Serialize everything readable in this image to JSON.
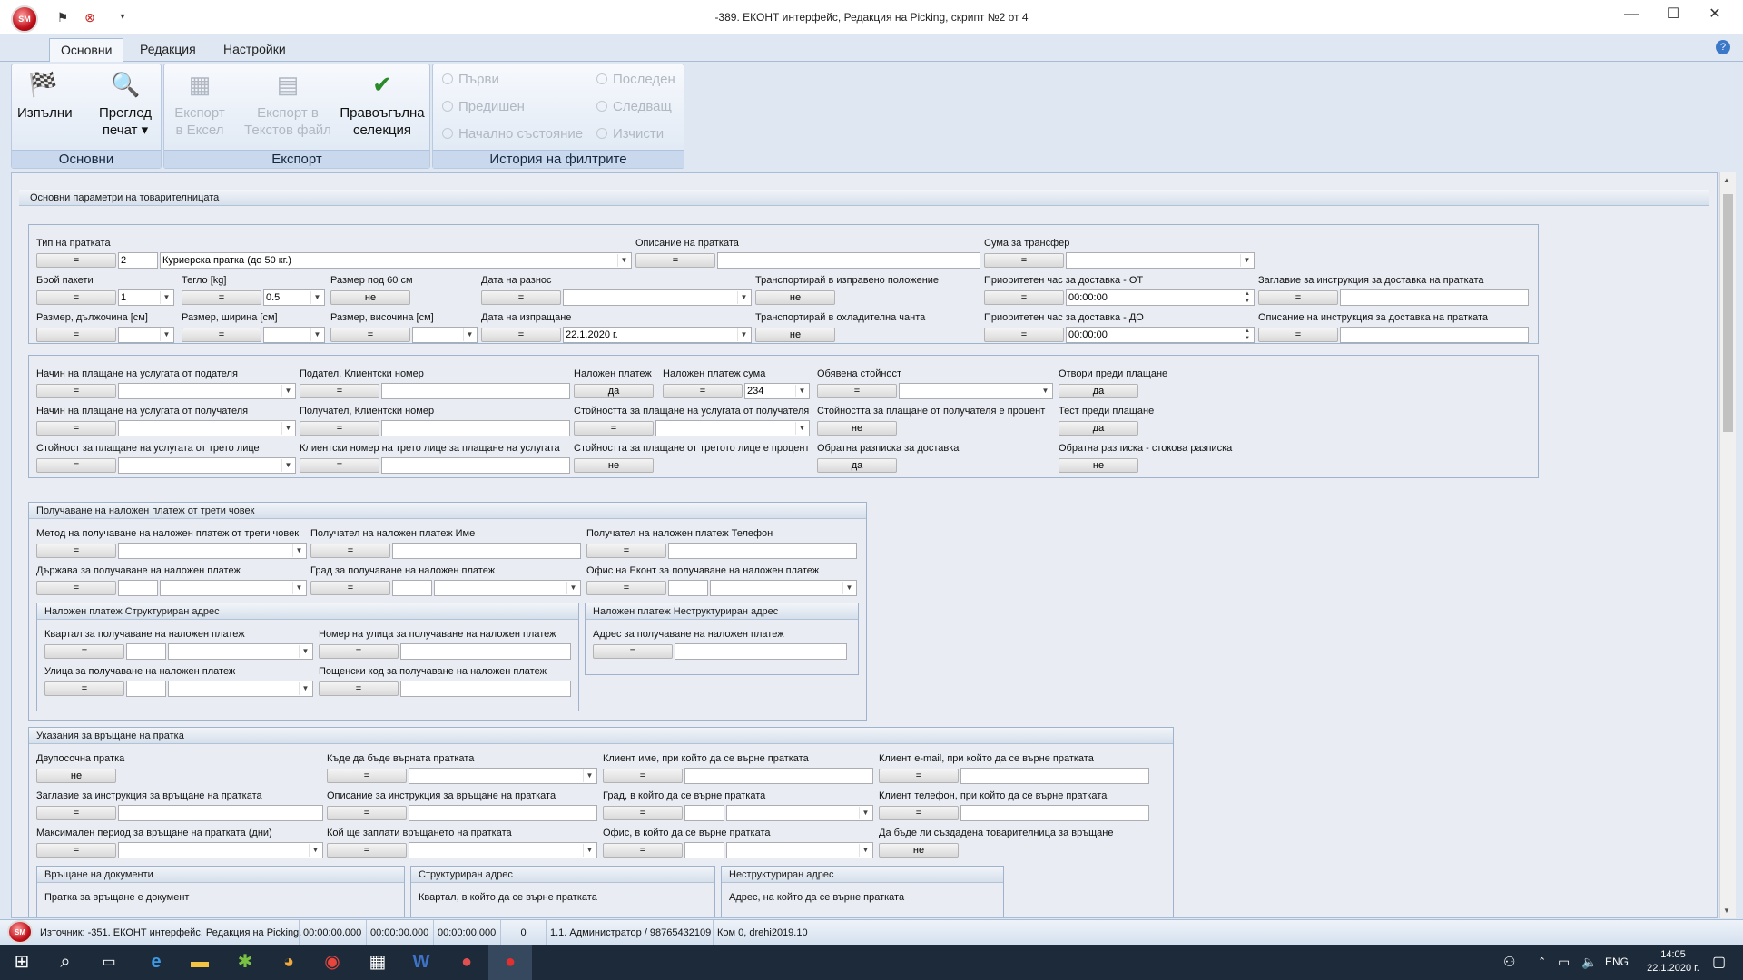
{
  "window": {
    "title": "-389. ЕКОНТ интерфейс, Редакция на Picking, скрипт №2 от 4",
    "app_logo": "SM",
    "controls": {
      "minimize": "—",
      "maximize": "☐",
      "close": "✕"
    }
  },
  "ribbon": {
    "tabs": [
      "Основни",
      "Редакция",
      "Настройки"
    ],
    "groups": {
      "osnovni": {
        "caption": "Основни",
        "buttons": [
          "Изпълни",
          "Преглед\nпечат ▾"
        ]
      },
      "export": {
        "caption": "Експорт",
        "buttons": [
          "Експорт\nв Ексел",
          "Експорт в\nТекстов файл",
          "Правоъгълна\nселекция"
        ]
      },
      "history": {
        "caption": "История на филтрите",
        "buttons": [
          "Първи",
          "Последен",
          "Предишен",
          "Следващ",
          "Начално състояние",
          "Изчисти"
        ]
      }
    }
  },
  "eq": "=",
  "sections": {
    "main": {
      "title": "Основни параметри на товарителницата"
    },
    "cod": {
      "title": "Получаване на наложен платеж от трети човек"
    },
    "codStruct": {
      "title": "Наложен платеж Структуриран адрес"
    },
    "codUnstruct": {
      "title": "Наложен платеж Неструктуриран адрес"
    },
    "ret": {
      "title": "Указания за връщане на пратка"
    },
    "retDocs": {
      "title": "Връщане на документи"
    },
    "retStruct": {
      "title": "Структуриран адрес"
    },
    "retUnstruct": {
      "title": "Неструктуриран адрес"
    }
  },
  "fields": {
    "tip": {
      "label": "Тип на пратката",
      "code": "2",
      "value": "Куриерска пратка (до 50 кг.)"
    },
    "opisanie": {
      "label": "Описание на пратката"
    },
    "suma": {
      "label": "Сума за трансфер"
    },
    "paketi": {
      "label": "Брой пакети",
      "value": "1"
    },
    "teglo": {
      "label": "Тегло [kg]",
      "value": "0.5"
    },
    "razmer60": {
      "label": "Размер под 60 см",
      "value": "не"
    },
    "razmer60_dup": {
      "label": "Размер под 60 см"
    },
    "dataRaznos": {
      "label": "Дата на разнос"
    },
    "izpraveno": {
      "label": "Транспортирай в изправено положение",
      "value": "не"
    },
    "prioOt": {
      "label": "Приоритетен час за доставка - ОТ",
      "value": "00:00:00"
    },
    "zaglavie": {
      "label": "Заглавие за инструкция за доставка на пратката"
    },
    "dalzhina": {
      "label": "Размер, дължочина [см]"
    },
    "shirina": {
      "label": "Размер, ширина [см]"
    },
    "visochina": {
      "label": "Размер, височина [см]"
    },
    "dataIzprashtane": {
      "label": "Дата на изпращане",
      "value": "22.1.2020 г."
    },
    "hladilna": {
      "label": "Транспортирай в охладителна чанта",
      "value": "не"
    },
    "prioDo": {
      "label": "Приоритетен час за доставка - ДО",
      "value": "00:00:00"
    },
    "opisInstr": {
      "label": "Описание на инструкция за доставка на пратката"
    },
    "plashtanePod": {
      "label": "Начин на плащане на услугата от подателя"
    },
    "podatelNomer": {
      "label": "Подател, Клиентски номер"
    },
    "nalozhen": {
      "label": "Наложен платеж",
      "value": "да"
    },
    "nalozhenSuma": {
      "label": "Наложен платеж сума",
      "value": "234"
    },
    "obyavena": {
      "label": "Обявена стойност"
    },
    "otvori": {
      "label": "Отвори преди плащане",
      "value": "да"
    },
    "plashtanePol": {
      "label": "Начин на плащане на услугата от получателя"
    },
    "poluchatelNomer": {
      "label": "Получател, Клиентски номер"
    },
    "stoynostPol": {
      "label": "Стойността за плащане на услугата от получателя"
    },
    "stoynostPolPct": {
      "label": "Стойността за плащане от получателя е процент",
      "value": "не"
    },
    "test": {
      "label": "Тест преди плащане",
      "value": "да"
    },
    "tretoLice": {
      "label": "Стойност за плащане на услугата от трето лице"
    },
    "tretoNomer": {
      "label": "Клиентски номер на трето лице за плащане на услугата"
    },
    "tretoPct": {
      "label": "Стойността за плащане от третото лице е процент",
      "value": "не"
    },
    "obratnaDost": {
      "label": "Обратна разписка за доставка",
      "value": "да"
    },
    "obratnaStok": {
      "label": "Обратна разписка - стокова разписка",
      "value": "не"
    },
    "metod": {
      "label": "Метод на получаване на наложен платеж от трети човек"
    },
    "codIme": {
      "label": "Получател на наложен платеж Име"
    },
    "codTel": {
      "label": "Получател на наложен платеж Телефон"
    },
    "codDarzhava": {
      "label": "Държава за получаване на наложен платеж"
    },
    "codGrad": {
      "label": "Град за получаване на наложен платеж"
    },
    "codOfis": {
      "label": "Офис на Еконт за получаване на наложен платеж"
    },
    "codKvartal": {
      "label": "Квартал за получаване на наложен платеж"
    },
    "codNomerUl": {
      "label": "Номер на улица за получаване на наложен платеж"
    },
    "codUlica": {
      "label": "Улица за получаване на наложен платеж"
    },
    "codPk": {
      "label": "Пощенски код за получаване на наложен платеж"
    },
    "codAdres": {
      "label": "Адрес за получаване на наложен платеж"
    },
    "dvuposochna": {
      "label": "Двупосочна пратка",
      "value": "не"
    },
    "kadeVarnata": {
      "label": "Къде да бъде върната пратката"
    },
    "klientIme": {
      "label": "Клиент име, при който да се върне пратката"
    },
    "klientEmail": {
      "label": "Клиент e-mail, при който да се върне пратката"
    },
    "zaglVrashtane": {
      "label": "Заглавие за инструкция за връщане на пратката"
    },
    "opisVrashtane": {
      "label": "Описание за инструкция за връщане на пратката"
    },
    "gradVrashtane": {
      "label": "Град, в който да се върне пратката"
    },
    "klientTel": {
      "label": "Клиент телефон, при който да се върне пратката"
    },
    "maxPeriod": {
      "label": "Максимален период за връщане на пратката (дни)"
    },
    "koyZaplati": {
      "label": "Кой ще заплати връщането на пратката"
    },
    "ofisVrashtane": {
      "label": "Офис, в който да се върне пратката"
    },
    "sazdadena": {
      "label": "Да бъде ли създадена товарителница за връщане",
      "value": "не"
    },
    "dokument": {
      "label": "Пратка за връщане е документ"
    },
    "kvartalVrashtane": {
      "label": "Квартал, в който да се върне пратката"
    },
    "adresVrashtane": {
      "label": "Адрес, на който да се върне пратката"
    }
  },
  "status": {
    "source": "Източник: -351. ЕКОНТ интерфейс, Редакция на Picking,",
    "t1": "00:00:00.000",
    "t2": "00:00:00.000",
    "t3": "00:00:00.000",
    "count": "0",
    "user": "1.1. Администратор / 98765432109",
    "kom": "Ком 0, drehi2019.10"
  },
  "taskbar": {
    "lang": "ENG",
    "time": "14:05",
    "date": "22.1.2020 г."
  }
}
